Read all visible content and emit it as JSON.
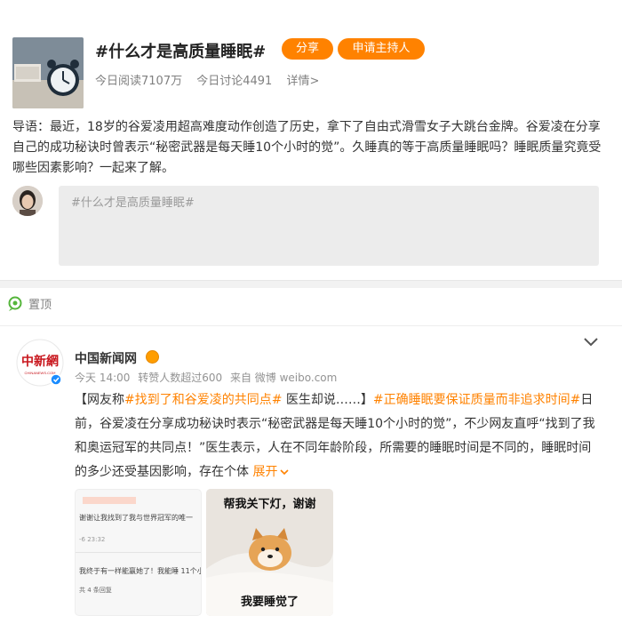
{
  "topic": {
    "title": "#什么才是高质量睡眠#",
    "share_label": "分享",
    "host_label": "申请主持人",
    "reads": "今日阅读7107万",
    "discussions": "今日讨论4491",
    "details": "详情>",
    "guide": "导语：最近，18岁的谷爱凌用超高难度动作创造了历史，拿下了自由式滑雪女子大跳台金牌。谷爱凌在分享自己的成功秘诀时曾表示“秘密武器是每天睡10个小时的觉”。久睡真的等于高质量睡眠吗？睡眠质量究竟受哪些因素影响？一起来了解。",
    "composer_placeholder": "#什么才是高质量睡眠#"
  },
  "feed": {
    "pinned_label": "置顶",
    "post": {
      "author": "中国新闻网",
      "avatar_logo_text": "中新網",
      "avatar_logo_sub": "CHINANEWS.COM",
      "meta_time": "今天 14:00",
      "meta_reposts": "转赞人数超过600",
      "meta_source": "来自 微博 weibo.com",
      "text_open": "【网友称",
      "tag1": "#找到了和谷爱凌的共同点#",
      "text_mid": " 医生却说……】",
      "tag2": "#正确睡眠要保证质量而非追求时间#",
      "text_body": "日前，谷爱凌在分享成功秘诀时表示“秘密武器是每天睡10个小时的觉”，不少网友直呼“找到了我和奥运冠军的共同点！”医生表示，人在不同年龄阶段，所需要的睡眠时间是不同的，睡眠时间的多少还受基因影响，存在个体",
      "expand_label": "展开",
      "image1_line1": "谢谢让我找到了我与世界冠军的唯一",
      "image1_time": "-6 23:32",
      "image1_line2": "我终于有一样能赢她了！我能睡 11个小",
      "image1_replies": "共 4 条回复",
      "image2_top": "帮我关下灯，谢谢",
      "image2_bottom": "我要睡觉了"
    }
  },
  "colors": {
    "accent": "#ff8200",
    "background": "#f2f2f2",
    "card": "#ffffff",
    "pin_green": "#55b53b"
  },
  "icons": {
    "pin": "pin-icon",
    "chevron": "chevron-down-icon",
    "verified": "verified-icon",
    "vip": "vip-badge-icon"
  }
}
